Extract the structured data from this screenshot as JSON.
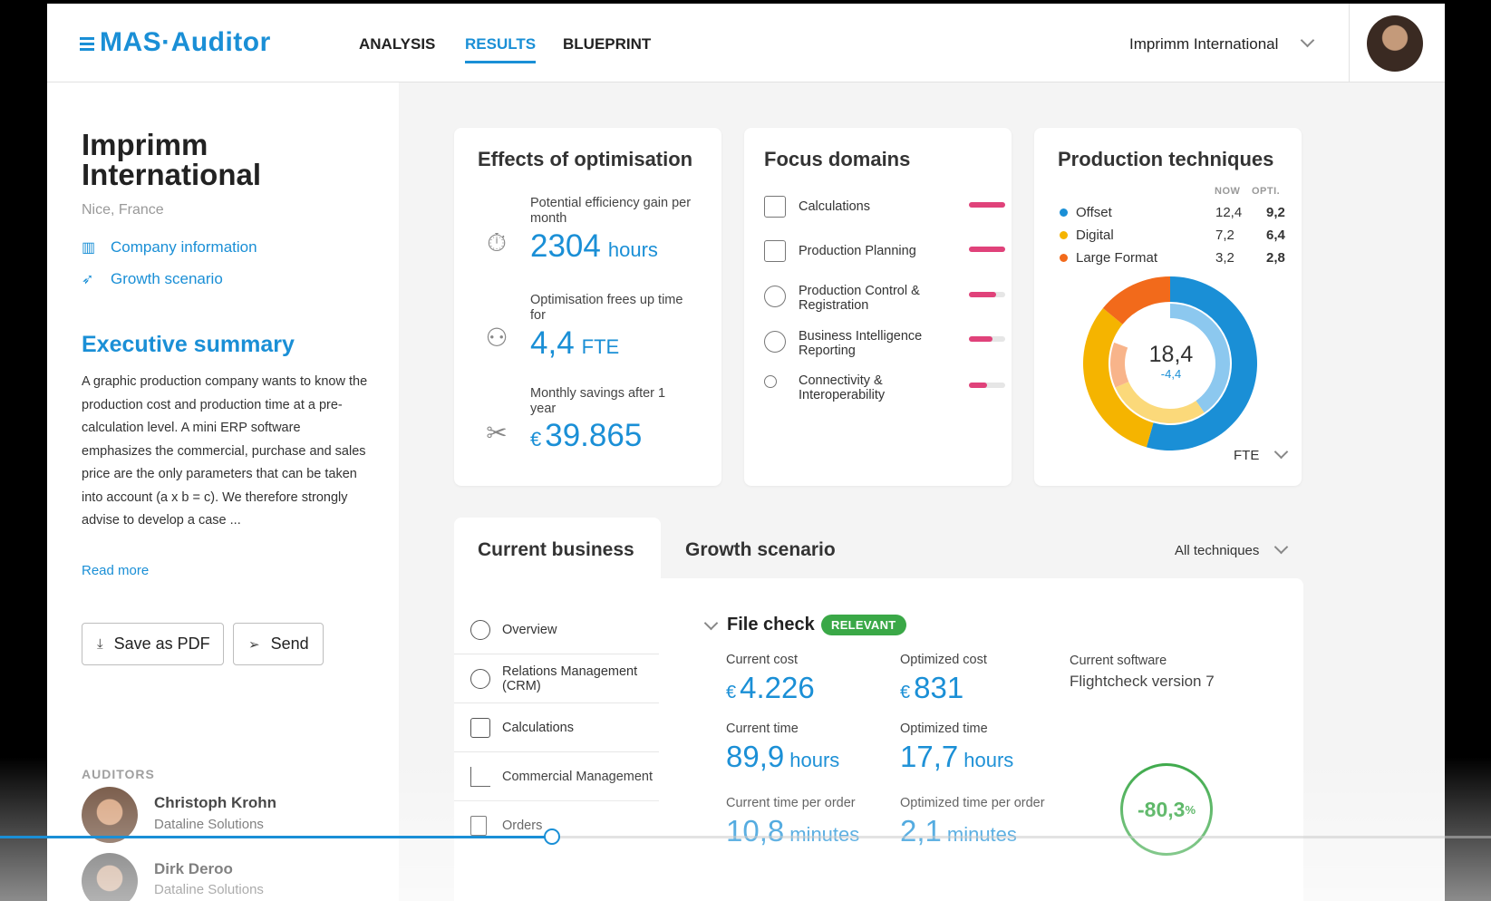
{
  "header": {
    "logo": "MAS·Auditor",
    "nav": [
      "ANALYSIS",
      "RESULTS",
      "BLUEPRINT"
    ],
    "active_nav": "RESULTS",
    "company_select": "Imprimm International"
  },
  "left": {
    "company_name": "Imprimm International",
    "location": "Nice, France",
    "links": [
      "Company information",
      "Growth scenario"
    ],
    "exec_title": "Executive summary",
    "exec_text": "A graphic production company wants to know the production cost and production time at a pre-calculation level. A mini ERP software emphasizes the commercial, purchase and sales price are the only parameters that can be taken into account (a x b = c). We therefore strongly advise to develop a case ...",
    "read_more": "Read more",
    "save_pdf": "Save as PDF",
    "send": "Send",
    "auditors_label": "AUDITORS",
    "auditors": [
      {
        "name": "Christoph Krohn",
        "org": "Dataline Solutions"
      },
      {
        "name": "Dirk Deroo",
        "org": "Dataline Solutions"
      }
    ]
  },
  "effects": {
    "title": "Effects of optimisation",
    "metrics": [
      {
        "label": "Potential efficiency gain per month",
        "value": "2304",
        "unit": "hours",
        "currency": ""
      },
      {
        "label": "Optimisation frees up time for",
        "value": "4,4",
        "unit": "FTE",
        "currency": ""
      },
      {
        "label": "Monthly savings after 1 year",
        "value": "39.865",
        "unit": "",
        "currency": "€"
      }
    ]
  },
  "focus": {
    "title": "Focus domains",
    "items": [
      {
        "label": "Calculations",
        "level": 1.0
      },
      {
        "label": "Production Planning",
        "level": 1.0
      },
      {
        "label": "Production Control & Registration",
        "level": 0.75
      },
      {
        "label": "Business Intelligence Reporting",
        "level": 0.65
      },
      {
        "label": "Connectivity & Interoperability",
        "level": 0.5
      }
    ],
    "accent": "#e0427a"
  },
  "production": {
    "title": "Production techniques",
    "col_now": "NOW",
    "col_opt": "OPTI.",
    "rows": [
      {
        "name": "Offset",
        "now": "12,4",
        "opt": "9,2",
        "color": "#1a8fd6"
      },
      {
        "name": "Digital",
        "now": "7,2",
        "opt": "6,4",
        "color": "#f5b400"
      },
      {
        "name": "Large Format",
        "now": "3,2",
        "opt": "2,8",
        "color": "#f26a1b"
      }
    ],
    "center_value": "18,4",
    "center_delta": "-4,4",
    "unit_select": "FTE"
  },
  "bottom": {
    "tabs": [
      "Current business",
      "Growth scenario"
    ],
    "filter": "All techniques",
    "sidebar": [
      "Overview",
      "Relations Management (CRM)",
      "Calculations",
      "Commercial Management",
      "Orders"
    ],
    "section_title": "File check",
    "badge": "RELEVANT",
    "current_cost_label": "Current cost",
    "current_cost": "4.226",
    "optimized_cost_label": "Optimized cost",
    "optimized_cost": "831",
    "software_label": "Current software",
    "software": "Flightcheck version 7",
    "current_time_label": "Current time",
    "current_time": "89,9",
    "optimized_time_label": "Optimized time",
    "optimized_time": "17,7",
    "time_unit": "hours",
    "cur_per_order_label": "Current time per order",
    "cur_per_order": "10,8",
    "opt_per_order_label": "Optimized time per order",
    "opt_per_order": "2,1",
    "per_order_unit": "minutes",
    "currency": "€",
    "reduction": "-80,3",
    "reduction_unit": "%"
  },
  "video": {
    "progress": 0.37
  }
}
